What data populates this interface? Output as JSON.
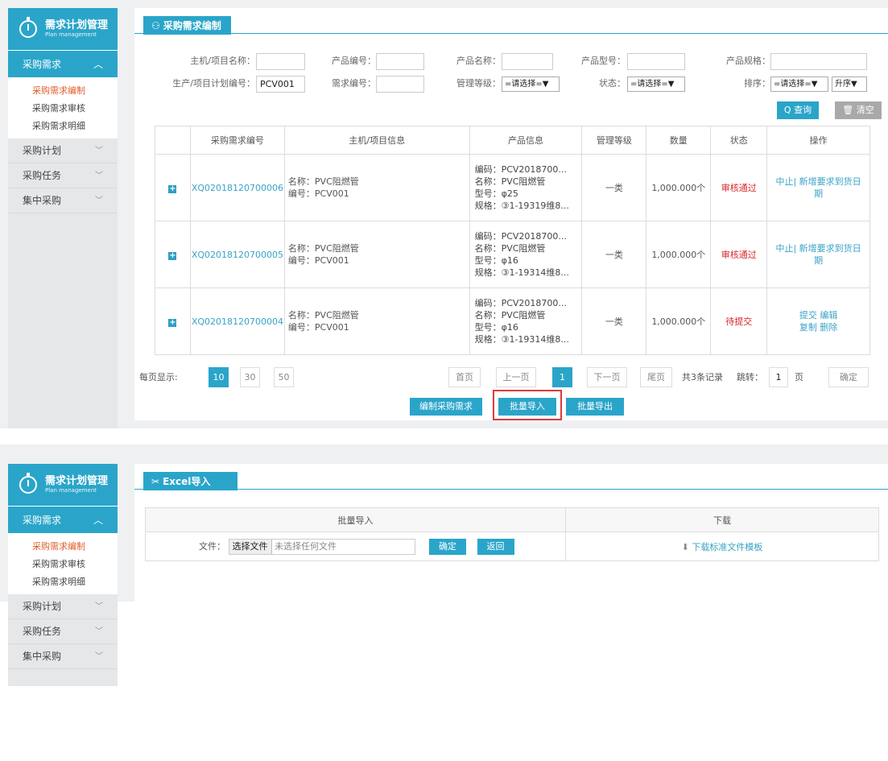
{
  "sidebar": {
    "title": "需求计划管理",
    "subtitle": "Plan management",
    "group_label": "采购需求",
    "group_chevron": "^",
    "sub_items": [
      "采购需求编制",
      "采购需求审核",
      "采购需求明细"
    ],
    "items": [
      "采购计划",
      "采购任务",
      "集中采购"
    ]
  },
  "top": {
    "tab_title": "采购需求编制",
    "filters": {
      "host_name_label": "主机/项目名称：",
      "product_code_label": "产品编号：",
      "product_name_label": "产品名称：",
      "product_model_label": "产品型号：",
      "product_spec_label": "产品规格：",
      "plan_code_label": "生产/项目计划编号：",
      "plan_code_value": "PCV001",
      "demand_code_label": "需求编号：",
      "mgmt_level_label": "管理等级：",
      "mgmt_level_value": "=请选择=▼",
      "status_label": "状态：",
      "status_value": "=请选择=▼",
      "sort_label": "排序：",
      "sort_value": "=请选择=▼",
      "order_value": "升序▼",
      "search_btn": "Q 查询",
      "clear_btn": "🗑 清空"
    },
    "columns": [
      "采购需求编号",
      "主机/项目信息",
      "产品信息",
      "管理等级",
      "数量",
      "状态",
      "操作"
    ],
    "rows": [
      {
        "code": "XQ02018120700006",
        "host_name": "名称：PVC阻燃管",
        "host_code": "编号：PCV001",
        "p_code": "编码：PCV2018700...",
        "p_name": "名称：PVC阻燃管",
        "p_model": "型号：φ25",
        "p_spec": "规格：③1-19319维8...",
        "level": "一类",
        "qty": "1,000.000个",
        "status": "审核通过",
        "op1": "中止| 新增要求到货日",
        "op2": "期"
      },
      {
        "code": "XQ02018120700005",
        "host_name": "名称：PVC阻燃管",
        "host_code": "编号：PCV001",
        "p_code": "编码：PCV2018700...",
        "p_name": "名称：PVC阻燃管",
        "p_model": "型号：φ16",
        "p_spec": "规格：③1-19314维8...",
        "level": "一类",
        "qty": "1,000.000个",
        "status": "审核通过",
        "op1": "中止| 新增要求到货日",
        "op2": "期"
      },
      {
        "code": "XQ02018120700004",
        "host_name": "名称：PVC阻燃管",
        "host_code": "编号：PCV001",
        "p_code": "编码：PCV2018700...",
        "p_name": "名称：PVC阻燃管",
        "p_model": "型号：φ16",
        "p_spec": "规格：③1-19314维8...",
        "level": "一类",
        "qty": "1,000.000个",
        "status": "待提交",
        "op1": "提交 编辑",
        "op2": "复制 删除"
      }
    ],
    "pager": {
      "per_page_label": "每页显示:",
      "sizes": [
        "10",
        "30",
        "50"
      ],
      "first": "首页",
      "prev": "上一页",
      "current": "1",
      "next": "下一页",
      "last": "尾页",
      "total": "共3条记录",
      "jump_label": "跳转：",
      "jump_value": "1",
      "page_unit": "页",
      "confirm": "确定"
    },
    "buttons": {
      "edit": "编制采购需求",
      "import": "批量导入",
      "export": "批量导出"
    }
  },
  "bottom": {
    "tab_title": "Excel导入",
    "col_import": "批量导入",
    "col_download": "下载",
    "file_label": "文件：",
    "choose_file": "选择文件",
    "no_file": "未选择任何文件",
    "ok": "确定",
    "back": "返回",
    "download_link": "下载标准文件模板"
  }
}
